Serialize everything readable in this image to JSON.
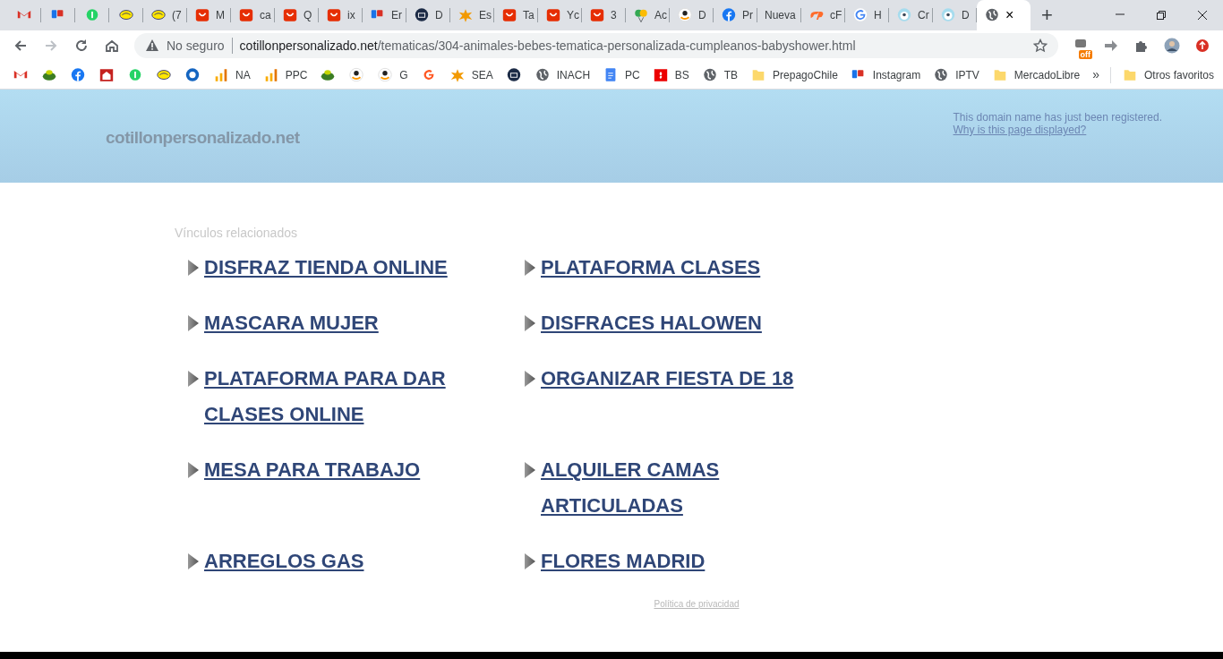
{
  "tabs": [
    {
      "kind": "gmail",
      "pinned": true,
      "selected": false
    },
    {
      "kind": "pp",
      "pinned": true,
      "selected": false
    },
    {
      "kind": "whatsapp",
      "pinned": true,
      "selected": false
    },
    {
      "kind": "meli",
      "pinned": true,
      "selected": false
    },
    {
      "kind": "meli",
      "title": "(7",
      "pinned": false,
      "selected": false
    },
    {
      "kind": "ali",
      "title": "M",
      "pinned": false,
      "selected": false
    },
    {
      "kind": "ali",
      "title": "ca",
      "pinned": false,
      "selected": false
    },
    {
      "kind": "ali",
      "title": "Q",
      "pinned": false,
      "selected": false
    },
    {
      "kind": "ali",
      "title": "ix",
      "pinned": false,
      "selected": false
    },
    {
      "kind": "pp",
      "title": "Er",
      "pinned": false,
      "selected": false
    },
    {
      "kind": "dark",
      "title": "D",
      "pinned": false,
      "selected": false
    },
    {
      "kind": "spark",
      "title": "Es",
      "pinned": false,
      "selected": false
    },
    {
      "kind": "ali",
      "title": "Ta",
      "pinned": false,
      "selected": false
    },
    {
      "kind": "ali",
      "title": "Yc",
      "pinned": false,
      "selected": false
    },
    {
      "kind": "ali",
      "title": "3",
      "pinned": false,
      "selected": false
    },
    {
      "kind": "balloons",
      "title": "Ac",
      "pinned": false,
      "selected": false
    },
    {
      "kind": "amazon",
      "title": "D",
      "pinned": false,
      "selected": false
    },
    {
      "kind": "facebook",
      "title": "Pr",
      "pinned": false,
      "selected": false
    },
    {
      "kind": "none",
      "title": "Nueva",
      "pinned": false,
      "selected": false
    },
    {
      "kind": "cpanel",
      "title": "cF",
      "pinned": false,
      "selected": false
    },
    {
      "kind": "google",
      "title": "H",
      "pinned": false,
      "selected": false
    },
    {
      "kind": "presta",
      "title": "Cr",
      "pinned": false,
      "selected": false
    },
    {
      "kind": "presta",
      "title": "D",
      "pinned": false,
      "selected": false
    },
    {
      "kind": "globe",
      "close": "×",
      "pinned": false,
      "selected": true
    }
  ],
  "new_tab": "+",
  "address_bar": {
    "security": "No seguro",
    "host": "cotillonpersonalizado.net",
    "path": "/tematicas/304-animales-bebes-tematica-personalizada-cumpleanos-babyshower.html"
  },
  "extensions": [
    {
      "kind": "coupon",
      "badge": "off"
    },
    {
      "kind": "arrow"
    },
    {
      "kind": "puzzle"
    },
    {
      "kind": "avatar"
    },
    {
      "kind": "update"
    }
  ],
  "bookmarks": [
    {
      "kind": "gmail"
    },
    {
      "kind": "leaf"
    },
    {
      "kind": "facebook"
    },
    {
      "kind": "house"
    },
    {
      "kind": "whatsapp"
    },
    {
      "kind": "meli"
    },
    {
      "kind": "bluecircle"
    },
    {
      "kind": "bars",
      "label": "NA"
    },
    {
      "kind": "bars",
      "label": "PPC"
    },
    {
      "kind": "leaf"
    },
    {
      "kind": "amazon"
    },
    {
      "kind": "amazon",
      "label": "G"
    },
    {
      "kind": "orangeg"
    },
    {
      "kind": "spark",
      "label": "SEA"
    },
    {
      "kind": "dark"
    },
    {
      "kind": "globe",
      "label": "INACH"
    },
    {
      "kind": "doc",
      "label": "PC"
    },
    {
      "kind": "redsq",
      "label": "BS"
    },
    {
      "kind": "globe",
      "label": "TB"
    },
    {
      "kind": "folder",
      "label": "PrepagoChile"
    },
    {
      "kind": "pp",
      "label": "Instagram"
    },
    {
      "kind": "globe",
      "label": "IPTV"
    },
    {
      "kind": "folder",
      "label": "MercadoLibre"
    }
  ],
  "bookmarks_more": "»",
  "other_bookmarks": {
    "label": "Otros favoritos"
  },
  "page": {
    "domain": "cotillonpersonalizado.net",
    "notice": "This domain name has just been registered.",
    "notice_link": "Why is this page displayed?",
    "related_title": "Vínculos relacionados",
    "links": [
      "DISFRAZ TIENDA ONLINE",
      "PLATAFORMA CLASES",
      "MASCARA MUJER",
      "DISFRACES HALOWEN",
      "PLATAFORMA PARA DAR CLASES ONLINE",
      "ORGANIZAR FIESTA DE 18",
      "MESA PARA TRABAJO",
      "ALQUILER CAMAS ARTICULADAS",
      "ARREGLOS GAS",
      "FLORES MADRID"
    ],
    "privacy": "Política de privacidad"
  }
}
